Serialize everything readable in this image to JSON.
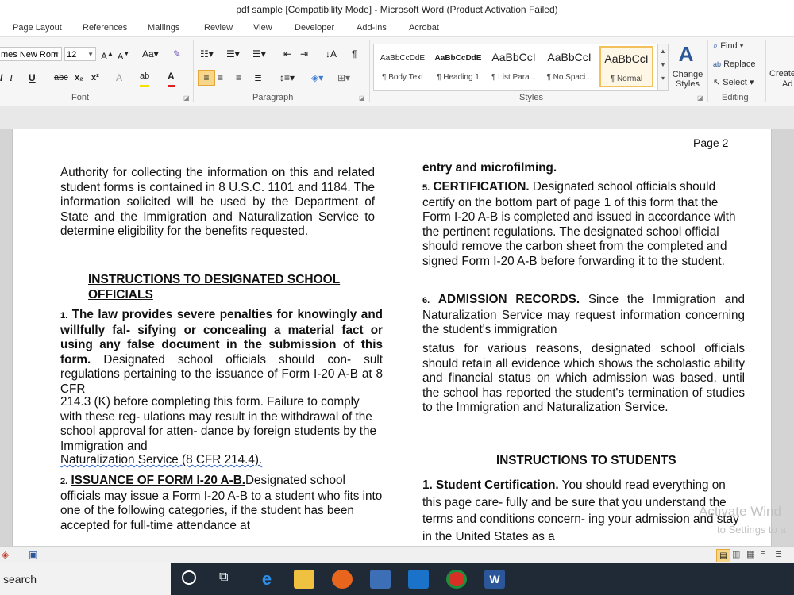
{
  "window": {
    "title": "pdf sample [Compatibility Mode]  -  Microsoft Word (Product Activation Failed)"
  },
  "tabs": [
    "Page Layout",
    "References",
    "Mailings",
    "Review",
    "View",
    "Developer",
    "Add-Ins",
    "Acrobat"
  ],
  "font": {
    "name": "mes New Rom",
    "size": "12",
    "group_label": "Font"
  },
  "paragraph": {
    "group_label": "Paragraph"
  },
  "styles": {
    "group_label": "Styles",
    "items": [
      {
        "sample": "AaBbCcDdE",
        "name": "¶ Body Text"
      },
      {
        "sample": "AaBbCcDdE",
        "name": "¶ Heading 1"
      },
      {
        "sample": "AaBbCcI",
        "name": "¶ List Para..."
      },
      {
        "sample": "AaBbCcI",
        "name": "¶ No Spaci..."
      },
      {
        "sample": "AaBbCcI",
        "name": "¶ Normal"
      }
    ],
    "change_styles": "Change Styles"
  },
  "editing": {
    "group_label": "Editing",
    "find": "Find",
    "replace": "Replace",
    "select": "Select",
    "create": "Create",
    "create2": "Ad"
  },
  "document": {
    "page_label": "Page 2",
    "left": {
      "p1": "Authority for collecting the information on this and related student forms is contained in 8 U.S.C. 1101 and 1184. The information solicited will be used by the Department of State and the Immigration and Naturalization Service to determine eligibility for the benefits requested.",
      "heading1": "INSTRUCTIONS TO DESIGNATED SCHOOL",
      "heading2": "OFFICIALS",
      "item1_num": "1.",
      "item1_bold": "The law provides severe penalties for knowingly and willfully fal- sifying or concealing a material fact or using any false document  in the submission of this form.",
      "item1_rest_a": "Designated school officials should con- sult regulations pertaining to the issuance of Form I-20 A-B at 8 CFR",
      "item1_rest_b": "214.3 (K) before completing this form. Failure to comply with these reg- ulations may result in the withdrawal of the school approval for atten- dance by foreign students by the Immigration and",
      "item1_rest_c": "Naturalization Service (8 CFR 214.4).",
      "item2_num": "2.",
      "item2_bold": "ISSUANCE OF FORM I-20 A-B.",
      "item2_rest": "Designated school officials may issue a Form I-20 A-B to a student who fits into one of the following categories, if the student has been accepted for full-time attendance at"
    },
    "right": {
      "p0": "entry and microfilming.",
      "item5_num": "5.",
      "item5_bold": "CERTIFICATION.",
      "item5_rest": "Designated school officials should certify on the bottom part of page 1 of this form that the Form I-20 A-B is completed and issued in accordance with the pertinent regulations. The designated school official should remove the carbon sheet from the completed and signed Form I-20 A-B before forwarding it to the student.",
      "item6_num": "6.",
      "item6_bold": "ADMISSION RECORDS.",
      "item6_rest_a": "Since the Immigration and Naturalization Service may request information concerning the student's immigration",
      "item6_rest_b": "status for various reasons, designated school officials should retain all evidence which shows the scholastic ability and financial status on which admission was based, until the school has reported the student's termination  of studies to the Immigration and Naturalization Service.",
      "heading": "INSTRUCTIONS TO STUDENTS",
      "s1_bold": "1. Student Certification.",
      "s1_rest": "You should read everything on this page care- fully and be sure that you understand the terms and conditions concern- ing your admission and stay in the United States as a"
    }
  },
  "watermark": {
    "line1": "Activate Wind",
    "line2": "to Settings to a"
  },
  "taskbar": {
    "search": "search"
  },
  "colors": {
    "accent": "#2b579a",
    "selected_style": "#f2c15b",
    "taskbar": "#1f2a36"
  }
}
